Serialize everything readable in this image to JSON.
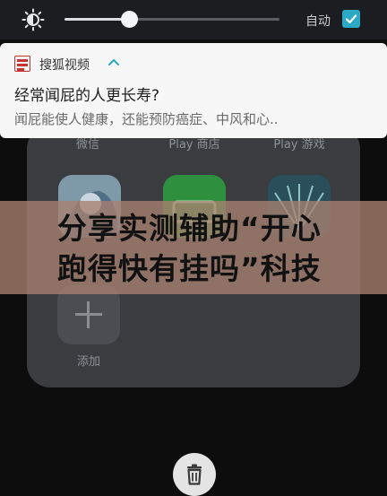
{
  "quick_settings": {
    "brightness_level": 0.3,
    "auto_brightness_label": "自动",
    "auto_brightness_checked": true,
    "icons": {
      "brightness": "brightness-icon",
      "auto_check": "checkbox-checked-icon"
    },
    "accent_color": "#2aa8c4"
  },
  "notification": {
    "app_name": "搜狐视频",
    "app_icon": "sohu-video-icon",
    "expand_icon": "chevron-up-icon",
    "title": "经常闻屁的人更长寿?",
    "body": "闻屁能使人健康，还能预防癌症、中风和心.."
  },
  "folder": {
    "labels": [
      "微信",
      "Play 商店",
      "Play 游戏"
    ],
    "add_label": "添加",
    "add_icon": "plus-icon"
  },
  "banner": {
    "text": "分享实测辅助“开心跑得快有挂吗”科技"
  },
  "bottom": {
    "trash_icon": "trash-icon"
  }
}
